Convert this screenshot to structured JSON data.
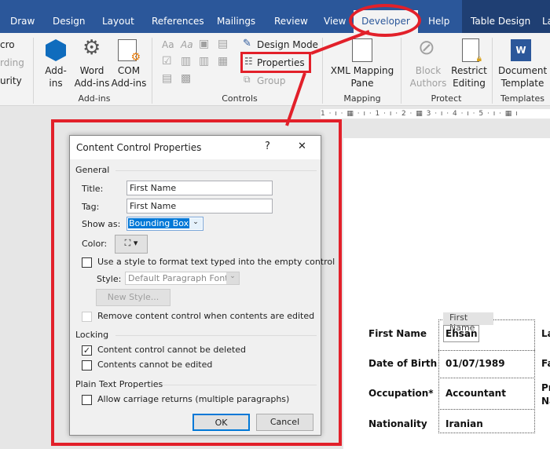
{
  "tabs": [
    "Draw",
    "Design",
    "Layout",
    "References",
    "Mailings",
    "Review",
    "View",
    "Developer",
    "Help",
    "Table Design",
    "La"
  ],
  "active_tab": "Developer",
  "ribbon": {
    "code_partial": [
      "cro",
      "rding",
      "urity"
    ],
    "addins": {
      "addins": "Add-\nins",
      "word_addins": "Word\nAdd-ins",
      "com_addins": "COM\nAdd-ins",
      "group": "Add-ins"
    },
    "controls": {
      "design_mode": "Design Mode",
      "properties": "Properties",
      "group_btn": "Group",
      "group": "Controls",
      "aa1": "Aa",
      "aa2": "Aa"
    },
    "mapping": {
      "xml": "XML Mapping\nPane",
      "group": "Mapping"
    },
    "protect": {
      "block": "Block\nAuthors",
      "restrict": "Restrict\nEditing",
      "group": "Protect"
    },
    "templates": {
      "doc": "Document\nTemplate",
      "group": "Templates"
    }
  },
  "ruler": "1 · ı · ▦ · ı · 1 · ı · 2 · ▦ 3 · ı · 4 · ı · 5 · ı · ▦ ı",
  "dialog": {
    "title": "Content Control Properties",
    "help": "?",
    "close": "✕",
    "general": "General",
    "title_label": "Title:",
    "title_value": "First Name",
    "tag_label": "Tag:",
    "tag_value": "First Name",
    "show_as_label": "Show as:",
    "show_as_value": "Bounding Box",
    "color_label": "Color:",
    "use_style": "Use a style to format text typed into the empty control",
    "use_style_checked": false,
    "style_label": "Style:",
    "style_value": "Default Paragraph Font",
    "new_style": "New Style...",
    "remove": "Remove content control when contents are edited",
    "remove_checked": false,
    "locking": "Locking",
    "cannot_delete": "Content control cannot be deleted",
    "cannot_delete_checked": true,
    "cannot_edit": "Contents cannot be edited",
    "cannot_edit_checked": false,
    "plain_text": "Plain Text Properties",
    "carriage": "Allow carriage returns (multiple paragraphs)",
    "carriage_checked": false,
    "ok": "OK",
    "cancel": "Cancel"
  },
  "document": {
    "cc_tag": "First Name",
    "rows": [
      {
        "label": "First Name",
        "value": "Ehsan",
        "right": "La"
      },
      {
        "label": "Date of Birth",
        "value": "01/07/1989",
        "right": "Fa"
      },
      {
        "label": "Occupation*",
        "value": "Accountant",
        "right": "Pr\nNa"
      },
      {
        "label": "Nationality",
        "value": "Iranian",
        "right": ""
      }
    ]
  },
  "colors": {
    "accent": "#2b579a",
    "annotation": "#e2202a",
    "selection": "#0078d7"
  }
}
